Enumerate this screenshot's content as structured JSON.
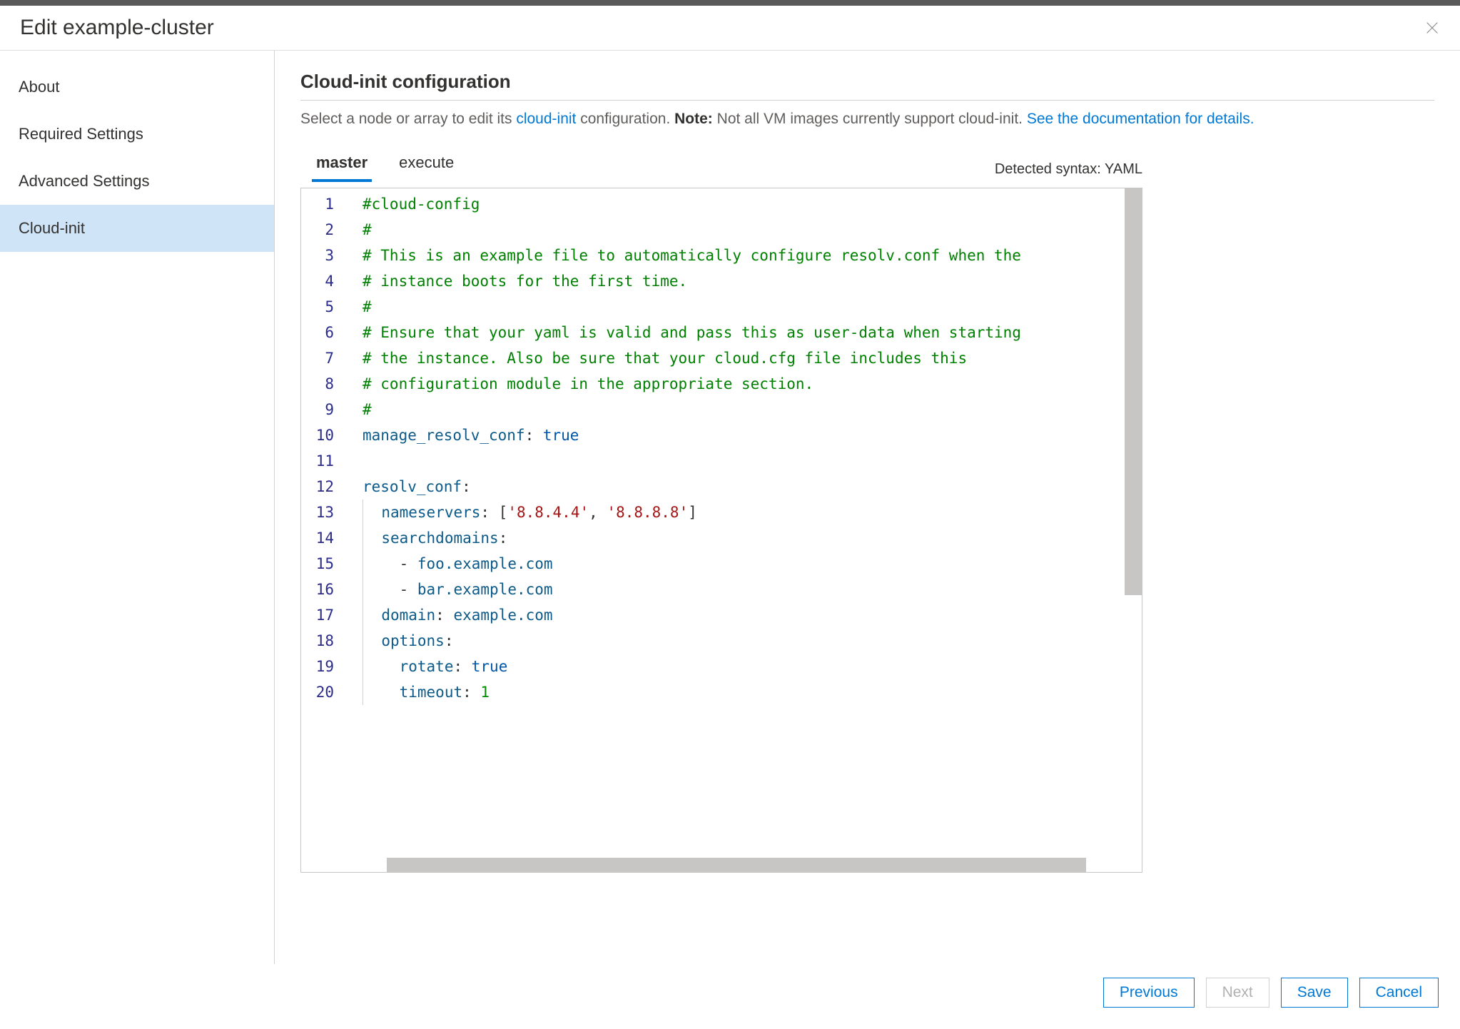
{
  "header": {
    "title": "Edit example-cluster"
  },
  "sidebar": {
    "items": [
      {
        "label": "About",
        "active": false
      },
      {
        "label": "Required Settings",
        "active": false
      },
      {
        "label": "Advanced Settings",
        "active": false
      },
      {
        "label": "Cloud-init",
        "active": true
      }
    ]
  },
  "main": {
    "section_title": "Cloud-init configuration",
    "help_prefix": "Select a node or array to edit its ",
    "help_link1": "cloud-init",
    "help_mid": " configuration. ",
    "help_note_label": "Note:",
    "help_note_text": " Not all VM images currently support cloud-init. ",
    "help_link2": "See the documentation for details.",
    "tabs": [
      {
        "label": "master",
        "active": true
      },
      {
        "label": "execute",
        "active": false
      }
    ],
    "syntax_prefix": "Detected syntax: ",
    "syntax_name": "YAML"
  },
  "editor": {
    "line_numbers": [
      "1",
      "2",
      "3",
      "4",
      "5",
      "6",
      "7",
      "8",
      "9",
      "10",
      "11",
      "12",
      "13",
      "14",
      "15",
      "16",
      "17",
      "18",
      "19",
      "20"
    ],
    "lines": [
      [
        {
          "cls": "c-comment",
          "text": "#cloud-config"
        }
      ],
      [
        {
          "cls": "c-comment",
          "text": "#"
        }
      ],
      [
        {
          "cls": "c-comment",
          "text": "# This is an example file to automatically configure resolv.conf when the"
        }
      ],
      [
        {
          "cls": "c-comment",
          "text": "# instance boots for the first time."
        }
      ],
      [
        {
          "cls": "c-comment",
          "text": "#"
        }
      ],
      [
        {
          "cls": "c-comment",
          "text": "# Ensure that your yaml is valid and pass this as user-data when starting"
        }
      ],
      [
        {
          "cls": "c-comment",
          "text": "# the instance. Also be sure that your cloud.cfg file includes this"
        }
      ],
      [
        {
          "cls": "c-comment",
          "text": "# configuration module in the appropriate section."
        }
      ],
      [
        {
          "cls": "c-comment",
          "text": "#"
        }
      ],
      [
        {
          "cls": "c-key",
          "text": "manage_resolv_conf"
        },
        {
          "cls": "c-punct",
          "text": ": "
        },
        {
          "cls": "c-bool",
          "text": "true"
        }
      ],
      [],
      [
        {
          "cls": "c-key",
          "text": "resolv_conf"
        },
        {
          "cls": "c-punct",
          "text": ":"
        }
      ],
      [
        {
          "cls": "",
          "text": "  ",
          "guide": true
        },
        {
          "cls": "c-key",
          "text": "nameservers"
        },
        {
          "cls": "c-punct",
          "text": ": ["
        },
        {
          "cls": "c-string",
          "text": "'8.8.4.4'"
        },
        {
          "cls": "c-punct",
          "text": ", "
        },
        {
          "cls": "c-string",
          "text": "'8.8.8.8'"
        },
        {
          "cls": "c-punct",
          "text": "]"
        }
      ],
      [
        {
          "cls": "",
          "text": "  ",
          "guide": true
        },
        {
          "cls": "c-key",
          "text": "searchdomains"
        },
        {
          "cls": "c-punct",
          "text": ":"
        }
      ],
      [
        {
          "cls": "",
          "text": "  ",
          "guide": true
        },
        {
          "cls": "c-punct",
          "text": "  - "
        },
        {
          "cls": "c-key",
          "text": "foo.example.com"
        }
      ],
      [
        {
          "cls": "",
          "text": "  ",
          "guide": true
        },
        {
          "cls": "c-punct",
          "text": "  - "
        },
        {
          "cls": "c-key",
          "text": "bar.example.com"
        }
      ],
      [
        {
          "cls": "",
          "text": "  ",
          "guide": true
        },
        {
          "cls": "c-key",
          "text": "domain"
        },
        {
          "cls": "c-punct",
          "text": ": "
        },
        {
          "cls": "c-key",
          "text": "example.com"
        }
      ],
      [
        {
          "cls": "",
          "text": "  ",
          "guide": true
        },
        {
          "cls": "c-key",
          "text": "options"
        },
        {
          "cls": "c-punct",
          "text": ":"
        }
      ],
      [
        {
          "cls": "",
          "text": "  ",
          "guide": true
        },
        {
          "cls": "c-punct",
          "text": "  "
        },
        {
          "cls": "c-key",
          "text": "rotate"
        },
        {
          "cls": "c-punct",
          "text": ": "
        },
        {
          "cls": "c-bool",
          "text": "true"
        }
      ],
      [
        {
          "cls": "",
          "text": "  ",
          "guide": true
        },
        {
          "cls": "c-punct",
          "text": "  "
        },
        {
          "cls": "c-key",
          "text": "timeout"
        },
        {
          "cls": "c-punct",
          "text": ": "
        },
        {
          "cls": "c-number",
          "text": "1"
        }
      ]
    ]
  },
  "footer": {
    "previous": "Previous",
    "next": "Next",
    "save": "Save",
    "cancel": "Cancel"
  }
}
